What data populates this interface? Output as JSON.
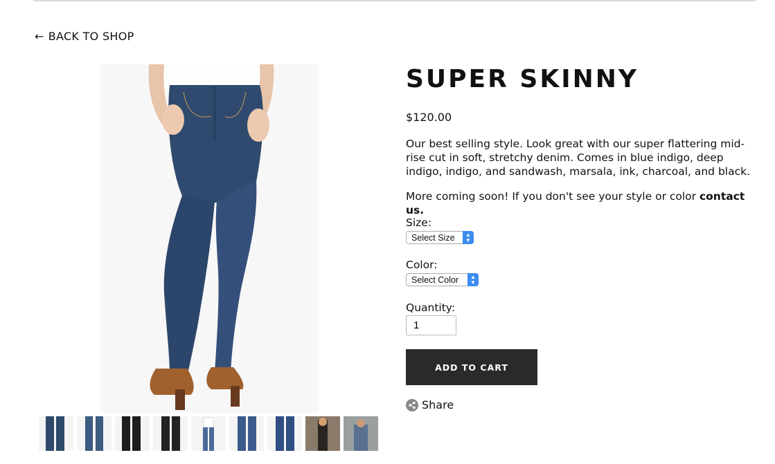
{
  "nav": {
    "back_arrow": "←",
    "back_label": "BACK TO SHOP"
  },
  "product": {
    "title": "SUPER SKINNY",
    "price": "$120.00",
    "description": "Our best selling style. Look great with our super flattering mid-rise cut in soft, stretchy denim. Comes in blue indigo, deep indigo, indigo, and sandwash, marsala, ink, charcoal, and black.",
    "more_text": "More coming soon! If you don't see your style or color ",
    "contact_link": "contact us."
  },
  "form": {
    "size_label": "Size:",
    "size_selected": "Select Size",
    "color_label": "Color:",
    "color_selected": "Select Color",
    "quantity_label": "Quantity:",
    "quantity_value": "1",
    "add_to_cart": "ADD TO CART"
  },
  "share": {
    "label": "Share",
    "icon": "share-icon"
  },
  "thumbnails": [
    {
      "color": "#2e4a6b"
    },
    {
      "color": "#3d5a80"
    },
    {
      "color": "#1e1e1e"
    },
    {
      "color": "#222222"
    },
    {
      "color": "#4a6a9a"
    },
    {
      "color": "#3b5b8c"
    },
    {
      "color": "#2f4f85"
    },
    {
      "color": "#5a4a3a"
    },
    {
      "color": "#6a6a6a"
    }
  ],
  "colors": {
    "button": "#2a2a2a",
    "denim": "#2f4a6e",
    "shoe": "#a0612f",
    "select_accent": "#3b8bf0"
  }
}
